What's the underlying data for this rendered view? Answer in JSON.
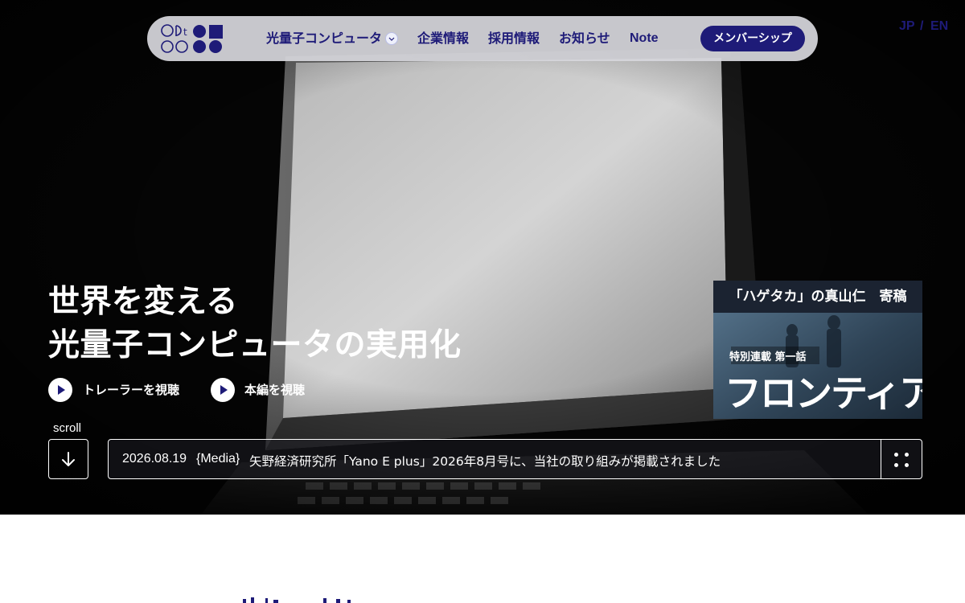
{
  "colors": {
    "brand": "#1e1b78",
    "nav_background": "#d6d6dc",
    "hero_background": "#000000",
    "text_on_dark": "#ffffff"
  },
  "header": {
    "logo": {
      "icon": "company-logo-icon",
      "text": "OPtQC"
    },
    "nav": {
      "quantum_computer": "光量子コンピュータ",
      "company_info": "企業情報",
      "recruitment": "採用情報",
      "news": "お知らせ",
      "note": "Note"
    },
    "dropdown_icon": "chevron-down-icon",
    "membership_label": "メンバーシップ"
  },
  "lang": {
    "jp": "JP",
    "separator": "/",
    "en": "EN"
  },
  "hero": {
    "headline_line1": "世界を変える",
    "headline_line2": "光量子コンピュータの実用化",
    "trailer_label": "トレーラーを視聴",
    "main_label": "本編を視聴",
    "play_icon": "play-icon"
  },
  "banner": {
    "top_text": "「ハゲタカ」の真山仁　寄稿",
    "subtitle": "特別連載 第一話",
    "title": "フロンティア"
  },
  "scroll": {
    "label": "scroll",
    "icon": "arrow-down-icon"
  },
  "news_ticker": {
    "date": "2026.08.19",
    "category": "{Media}",
    "title": "矢野経済研究所「Yano E plus」2026年8月号に、当社の取り組みが掲載されました",
    "grid_icon": "grid-dots-icon"
  }
}
